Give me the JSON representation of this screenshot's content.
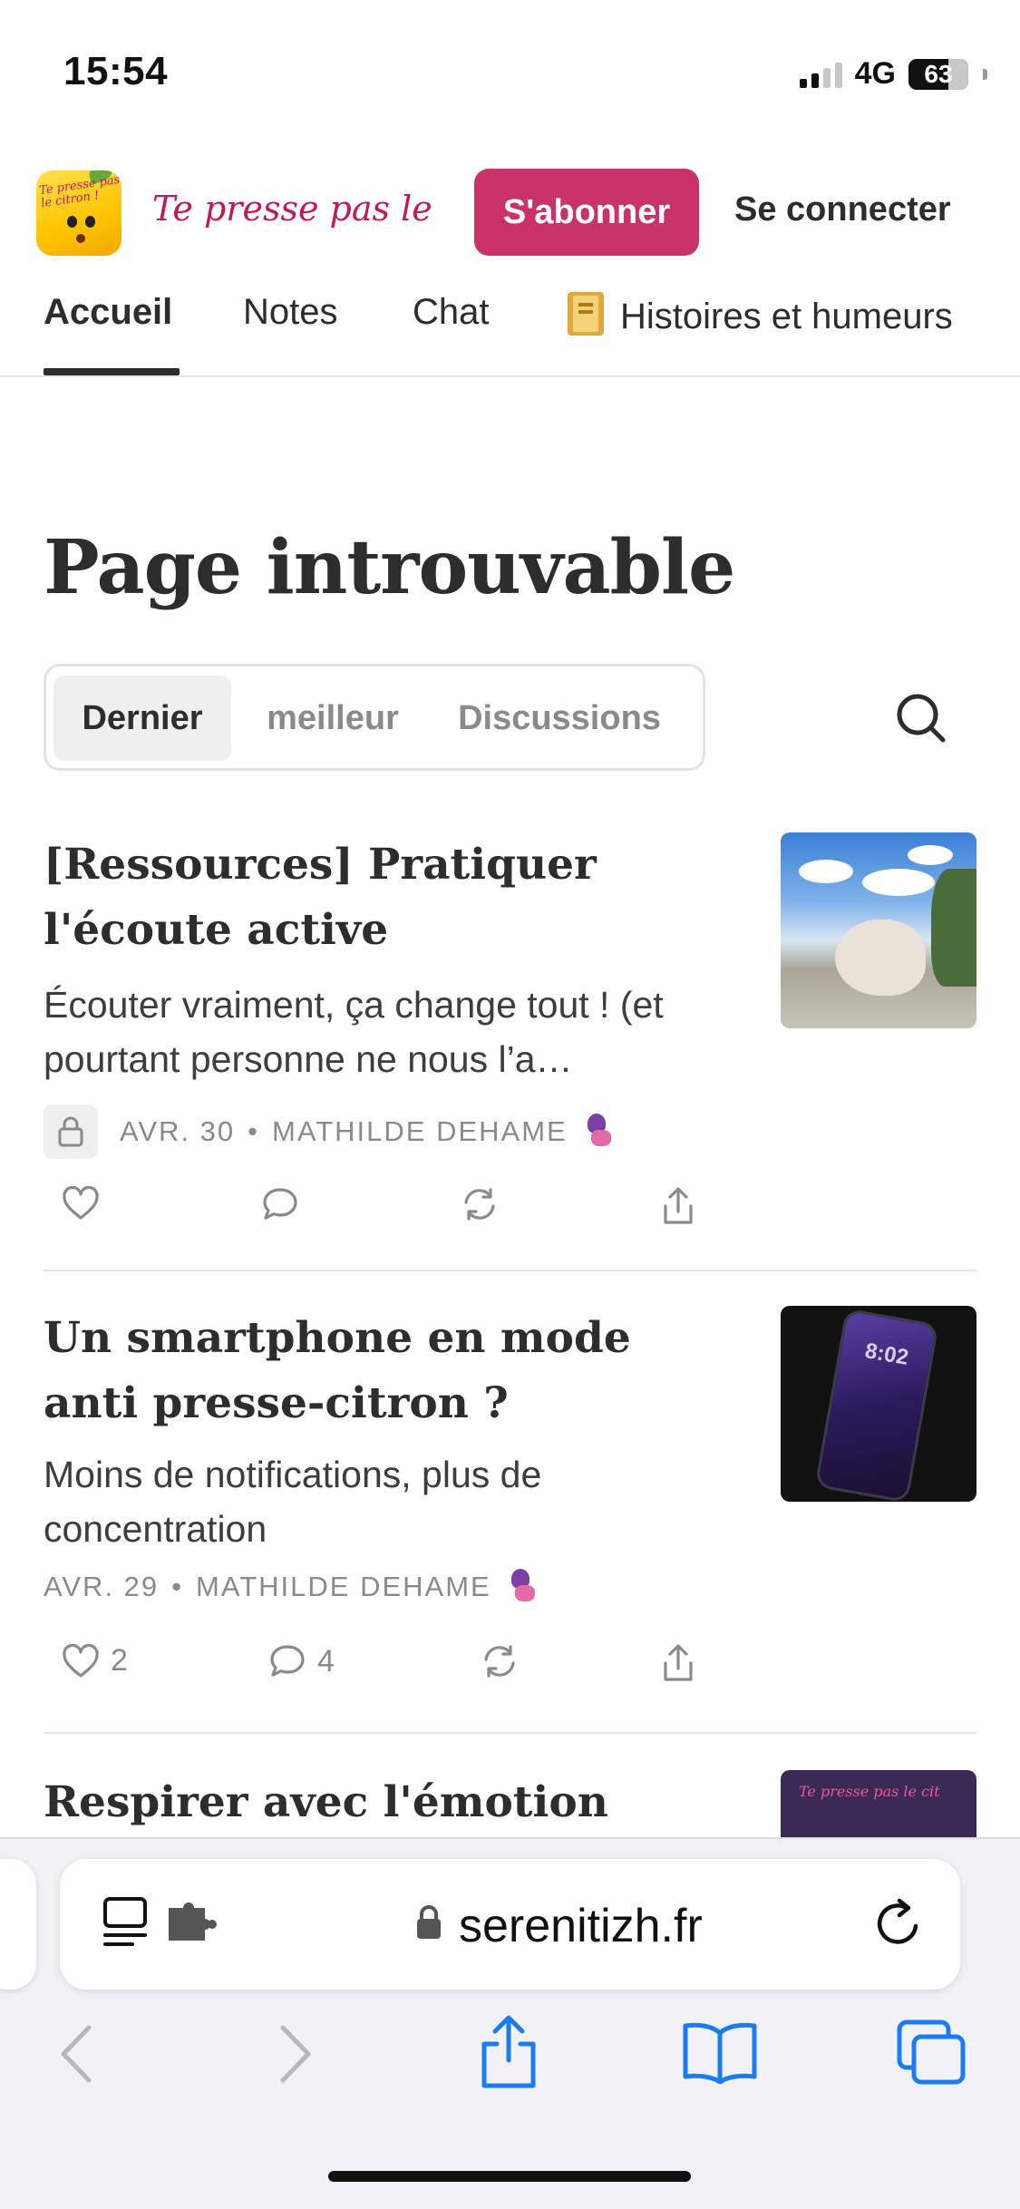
{
  "status_bar": {
    "time": "15:54",
    "network": "4G",
    "battery": "63"
  },
  "publication": {
    "logo_text": "Te presse pas le citron !",
    "wordmark": "Te presse pas le citr",
    "subscribe_label": "S'abonner",
    "login_label": "Se connecter"
  },
  "nav": {
    "tabs": [
      {
        "label": "Accueil",
        "active": true
      },
      {
        "label": "Notes"
      },
      {
        "label": "Chat"
      },
      {
        "label": "Histoires et humeurs",
        "icon": "book-icon"
      }
    ]
  },
  "page": {
    "title": "Page introuvable"
  },
  "sort": {
    "tabs": [
      {
        "label": "Dernier",
        "active": true
      },
      {
        "label": "meilleur"
      },
      {
        "label": "Discussions"
      }
    ]
  },
  "posts": [
    {
      "title": "[Ressources] Pratiquer l'écoute active",
      "subtitle": "Écouter vraiment, ça change tout ! (et pourtant personne ne nous l’a…",
      "date": "AVR. 30",
      "author": "MATHILDE DEHAME",
      "locked": true,
      "likes": "",
      "comments": ""
    },
    {
      "title": "Un smartphone en mode anti presse-citron ?",
      "subtitle": "Moins de notifications, plus de concentration",
      "date": "AVR. 29",
      "author": "MATHILDE DEHAME",
      "locked": false,
      "likes": "2",
      "comments": "4",
      "thumb_text": "8:02"
    },
    {
      "title": "Respirer avec l'émotion",
      "thumb_text": "Te presse pas le cit"
    }
  ],
  "meta_separator": "•",
  "browser": {
    "url": "serenitizh.fr"
  },
  "colors": {
    "accent": "#c9336a",
    "text": "#2d2d2d",
    "muted": "#8a8a8a",
    "ios_blue": "#1a7cf5"
  }
}
